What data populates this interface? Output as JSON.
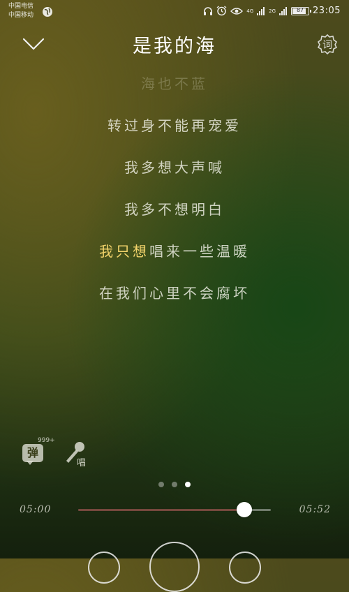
{
  "status_bar": {
    "carrier_1": "中国电信",
    "carrier_2": "中国移动",
    "net_1": "4G",
    "net_2": "2G",
    "battery_percent": "87",
    "battery_level": 0.87,
    "time": "23:05",
    "icons": [
      "globe-icon",
      "headphone-icon",
      "alarm-icon",
      "eye-icon",
      "signal-icon",
      "battery-icon"
    ]
  },
  "header": {
    "title": "是我的海",
    "collapse_icon": "chevron-down-icon",
    "lyrics_toggle_label": "词"
  },
  "lyrics": [
    {
      "text": "海也不蓝",
      "state": "faded"
    },
    {
      "text": "转过身不能再宠爱",
      "state": "normal"
    },
    {
      "text": "我多想大声喊",
      "state": "normal"
    },
    {
      "text": "我多不想明白",
      "state": "normal"
    },
    {
      "text_highlighted": "我只想",
      "text_rest": "唱来一些温暖",
      "state": "current"
    },
    {
      "text": "在我们心里不会腐坏",
      "state": "normal"
    }
  ],
  "side_actions": {
    "danmu_label": "弹",
    "danmu_count": "999+",
    "sing_label": "唱"
  },
  "page_indicator": {
    "count": 3,
    "active": 2
  },
  "progress": {
    "current": "05:00",
    "total": "05:52",
    "fraction": 0.862
  },
  "colors": {
    "highlight": "#f2d36b",
    "lyric": "#f0f0e6"
  }
}
